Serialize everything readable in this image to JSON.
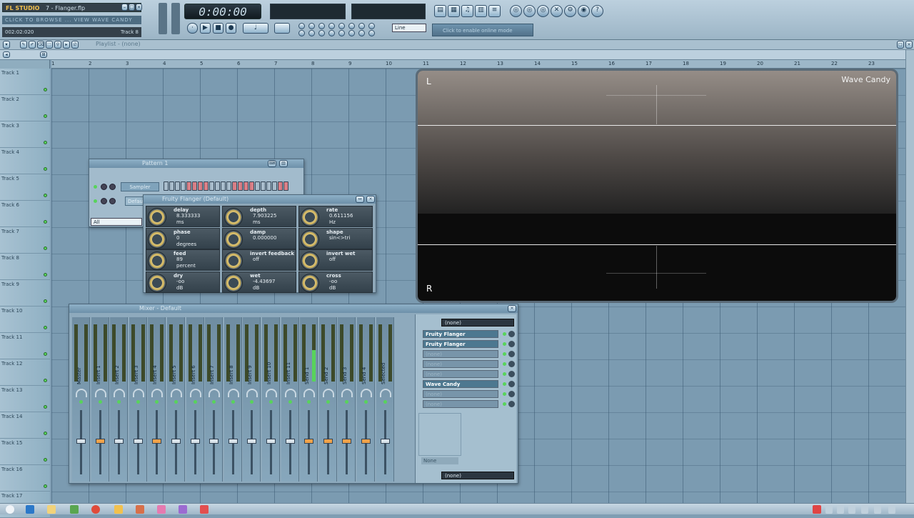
{
  "app": {
    "logo": "FL STUDIO",
    "project_title": "7 - Flanger.flp",
    "hint_scroll": "CLICK TO BROWSE ... VIEW WAVE CANDY ... TRACK 8",
    "song_position": "002:02:020",
    "focused_track": "Track 8",
    "clock": "0:00:00",
    "hint_panel": "Click to enable online mode",
    "snap_value": "Line"
  },
  "playlist": {
    "title": "Playlist - (none)",
    "ruler_ticks": [
      "1",
      "2",
      "3",
      "4",
      "5",
      "6",
      "7",
      "8",
      "9",
      "10",
      "11",
      "12",
      "13",
      "14",
      "15",
      "16",
      "17",
      "18",
      "19",
      "20",
      "21",
      "22",
      "23"
    ],
    "tracks": [
      "Track 1",
      "Track 2",
      "Track 3",
      "Track 4",
      "Track 5",
      "Track 6",
      "Track 7",
      "Track 8",
      "Track 9",
      "Track 10",
      "Track 11",
      "Track 12",
      "Track 13",
      "Track 14",
      "Track 15",
      "Track 16",
      "Track 17"
    ]
  },
  "pattern_window": {
    "title": "Pattern 1",
    "channel_1": "Sampler",
    "channel_2": "Default",
    "filter_label": "All"
  },
  "flanger": {
    "title": "Fruity Flanger (Default)",
    "params": [
      {
        "label": "delay",
        "value": "8.333333",
        "unit": "ms"
      },
      {
        "label": "depth",
        "value": "7.903225",
        "unit": "ms"
      },
      {
        "label": "rate",
        "value": "0.611156",
        "unit": "Hz"
      },
      {
        "label": "phase",
        "value": "0",
        "unit": "degrees"
      },
      {
        "label": "damp",
        "value": "0.000000",
        "unit": ""
      },
      {
        "label": "shape",
        "value": "sin<>tri",
        "unit": ""
      },
      {
        "label": "feed",
        "value": "89",
        "unit": "percent"
      },
      {
        "label": "invert feedback",
        "value": "off",
        "unit": ""
      },
      {
        "label": "invert wet",
        "value": "off",
        "unit": ""
      },
      {
        "label": "dry",
        "value": "-oo",
        "unit": "dB"
      },
      {
        "label": "wet",
        "value": "-4.43697",
        "unit": "dB"
      },
      {
        "label": "cross",
        "value": "-oo",
        "unit": "dB"
      }
    ]
  },
  "wave_candy": {
    "title": "Wave Candy",
    "left_label": "L",
    "right_label": "R"
  },
  "mixer": {
    "title": "Mixer - Default",
    "strips": [
      "Master",
      "Insert 1",
      "Insert 2",
      "Insert 3",
      "Insert 4",
      "Insert 5",
      "Insert 6",
      "Insert 7",
      "Insert 8",
      "Insert 9",
      "Insert 10",
      "Insert 11",
      "Send 1",
      "Send 2",
      "Send 3",
      "Send 4",
      "Selected"
    ],
    "input_label": "(none)",
    "output_label": "(none)",
    "fx_slots": [
      {
        "name": "Fruity Flanger",
        "active": true
      },
      {
        "name": "Fruity Flanger",
        "active": true
      },
      {
        "name": "(none)",
        "active": false
      },
      {
        "name": "(none)",
        "active": false
      },
      {
        "name": "(none)",
        "active": false
      },
      {
        "name": "Wave Candy",
        "active": true
      },
      {
        "name": "(none)",
        "active": false
      },
      {
        "name": "(none)",
        "active": false
      }
    ],
    "name_field": "None"
  },
  "colors": {
    "accent": "#7b9bb1",
    "meter_green": "#58d35b",
    "fader_orange": "#f0a24a"
  }
}
